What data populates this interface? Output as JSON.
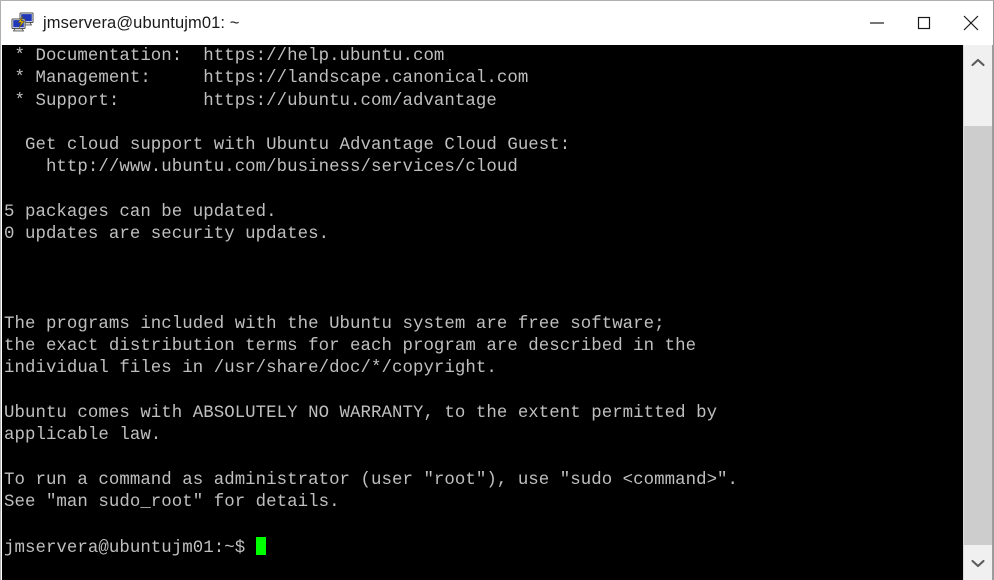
{
  "window": {
    "title": "jmservera@ubuntujm01: ~",
    "icon": "putty-icon",
    "controls": {
      "minimize_label": "Minimize",
      "maximize_label": "Maximize",
      "close_label": "Close"
    },
    "background_color": "#ffffff"
  },
  "terminal": {
    "background_color": "#000000",
    "foreground_color": "#bfbfbf",
    "cursor_color": "#00ff00",
    "font_size_px": 17,
    "lines": [
      " * Documentation:  https://help.ubuntu.com",
      " * Management:     https://landscape.canonical.com",
      " * Support:        https://ubuntu.com/advantage",
      "",
      "  Get cloud support with Ubuntu Advantage Cloud Guest:",
      "    http://www.ubuntu.com/business/services/cloud",
      "",
      "5 packages can be updated.",
      "0 updates are security updates.",
      "",
      "",
      "",
      "The programs included with the Ubuntu system are free software;",
      "the exact distribution terms for each program are described in the",
      "individual files in /usr/share/doc/*/copyright.",
      "",
      "Ubuntu comes with ABSOLUTELY NO WARRANTY, to the extent permitted by",
      "applicable law.",
      "",
      "To run a command as administrator (user \"root\"), use \"sudo <command>\".",
      "See \"man sudo_root\" for details.",
      ""
    ],
    "prompt": "jmservera@ubuntujm01:~$ ",
    "command_input": ""
  },
  "scrollbar": {
    "up_arrow": "chevron-up-icon",
    "down_arrow": "chevron-down-icon",
    "thumb_color": "#cdcdcd",
    "track_color": "#f0f0f0"
  }
}
